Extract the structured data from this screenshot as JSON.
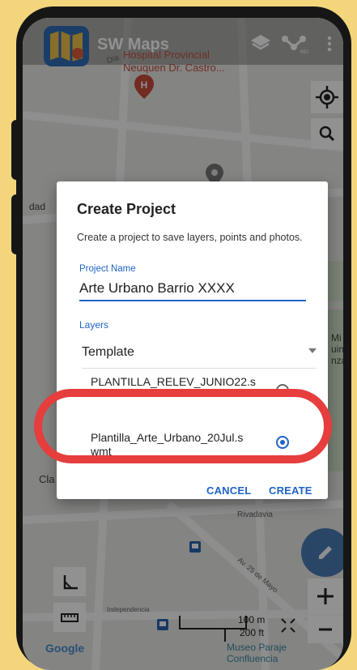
{
  "app": {
    "title": "SW Maps"
  },
  "map": {
    "poi_name": "Hospital Provincial\nNeuquen Dr. Castro...",
    "street_fragment": "Dia",
    "left_fragment": "dad",
    "left_fragment_2": "Cla",
    "right_fragment": "Mi\nuin Y\nnza",
    "street_rivadavia": "Rivadavia",
    "street_25_mayo": "Av. 25 de Mayo",
    "street_independencia": "Independencia",
    "scale_metric": "100 m",
    "scale_imperial": "200 ft",
    "museum_label": "Museo Paraje\nConfluencia",
    "google_label": "Google"
  },
  "dialog": {
    "title": "Create Project",
    "description": "Create a project to save layers, points and photos.",
    "project_name_label": "Project Name",
    "project_name_value": "Arte Urbano Barrio XXXX",
    "layers_label": "Layers",
    "template_label": "Template",
    "options": [
      {
        "label": "PLANTILLA_RELEV_JUNIO22.s",
        "checked": false
      },
      {
        "label": "Plantilla_Arte_Urbano_20Jul.s\nwmt",
        "checked": true
      }
    ],
    "cancel_label": "CANCEL",
    "create_label": "CREATE"
  },
  "colors": {
    "background": "#f3d57c",
    "accent": "#1e64c8",
    "highlight": "#e63d3d",
    "poi": "#c0533d"
  },
  "icons": [
    "map-logo-icon",
    "layers-icon",
    "rec-icon",
    "more-vert-icon",
    "gps-icon",
    "search-icon",
    "hospital-pin-icon",
    "location-pin-icon",
    "edit-icon",
    "measure-angle-icon",
    "ruler-icon",
    "zoom-in-icon",
    "zoom-out-icon",
    "fullscreen-icon",
    "bus-stop-icon"
  ]
}
